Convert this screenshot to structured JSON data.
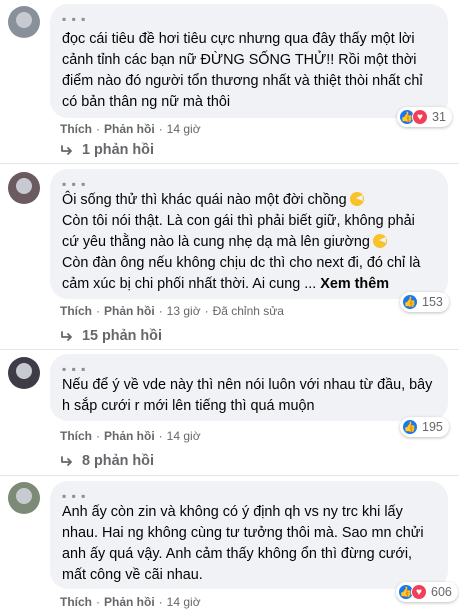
{
  "comments": [
    {
      "author": "▪ ▪ ▪",
      "lines": [
        "đọc cái tiêu đề hơi tiêu cực nhưng qua đây thấy một lời",
        "cảnh tỉnh các bạn nữ ĐỪNG SỐNG THỬ!! Rồi một thời",
        "điểm nào đó người tổn thương nhất và thiệt thòi nhất chỉ",
        "có bản thân ng nữ mà thôi"
      ],
      "like": "Thích",
      "reply": "Phản hồi",
      "time": "14 giờ",
      "reaction_count": "31",
      "reaction_icons": [
        "like-icon",
        "love-icon"
      ],
      "replies_label": "1 phản hồi"
    },
    {
      "author": "▪ ▪ ▪",
      "lines": [
        "Ôi sống thử thì khác quái nào một đời chồng",
        "Còn tôi nói thật. Là con gái thì phải biết giữ, không phải",
        "cứ yêu thằng nào là cung nhẹ dạ mà lên giường",
        "Còn đàn ông nếu không chịu dc thì cho next đi, đó chỉ là",
        "cảm xúc bị chi phối nhất thời. Ai cung ..."
      ],
      "see_more": "Xem thêm",
      "like": "Thích",
      "reply": "Phản hồi",
      "time": "13 giờ",
      "edited": "Đã chỉnh sửa",
      "reaction_count": "153",
      "reaction_icons": [
        "like-icon"
      ],
      "replies_label": "15 phản hồi"
    },
    {
      "author": "▪ ▪ ▪",
      "lines": [
        "Nếu để ý về vde này thì nên nói luôn với nhau từ đầu, bây",
        "h sắp cưới r mới lên tiếng thì quá muộn"
      ],
      "like": "Thích",
      "reply": "Phản hồi",
      "time": "14 giờ",
      "reaction_count": "195",
      "reaction_icons": [
        "like-icon"
      ],
      "replies_label": "8 phản hồi"
    },
    {
      "author": "▪ ▪ ▪",
      "lines": [
        "Anh ấy còn zin và không có ý định qh vs ny trc khi lấy",
        "nhau. Hai ng không cùng tư tưởng thôi mà. Sao mn chửi",
        "anh ấy quá vậy. Anh cảm thấy không ổn thì đừng cưới,",
        "mất công về cãi nhau."
      ],
      "like": "Thích",
      "reply": "Phản hồi",
      "time": "14 giờ",
      "reaction_count": "606",
      "reaction_icons": [
        "like-icon",
        "love-icon"
      ]
    }
  ],
  "colors": {
    "like": "#1877f2",
    "love": "#f33e58",
    "bubble": "#f0f2f5",
    "meta": "#65676b"
  }
}
